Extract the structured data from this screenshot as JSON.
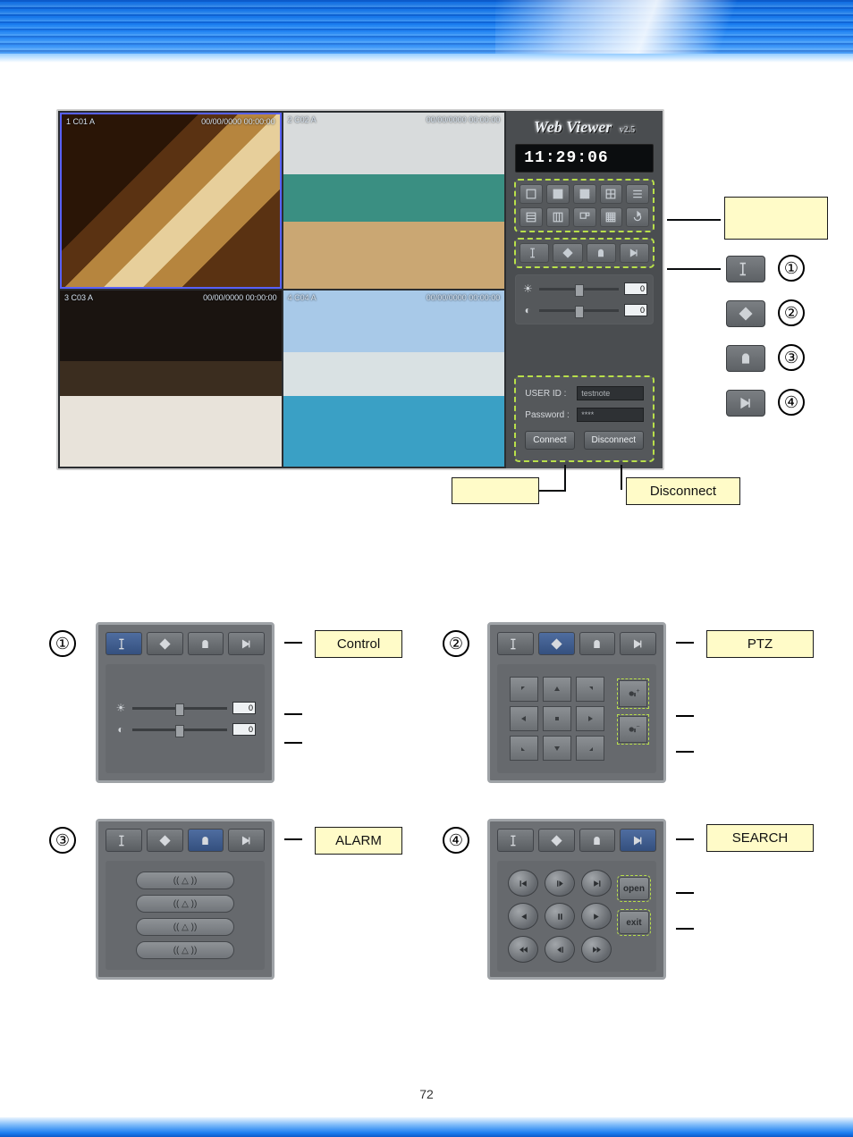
{
  "page_number": "72",
  "viewer": {
    "title": "Web Viewer",
    "version": "v2.5",
    "clock": "11:29:06",
    "feeds": [
      {
        "osd_left": "1 C01  A",
        "osd_right": "00/00/0000\n00:00:00"
      },
      {
        "osd_left": "2 C02  A",
        "osd_right": "00/00/0000\n00:00:00"
      },
      {
        "osd_left": "3 C03  A",
        "osd_right": "00/00/0000\n00:00:00"
      },
      {
        "osd_left": "4 C04  A",
        "osd_right": "00/00/0000\n00:00:00"
      }
    ],
    "slider1_value": "0",
    "slider2_value": "0",
    "login": {
      "user_label": "USER ID :",
      "pass_label": "Password :",
      "user_value": "testnote",
      "pass_value": "****",
      "connect": "Connect",
      "disconnect": "Disconnect"
    }
  },
  "callouts": {
    "screen_division": "",
    "tab_legend": {
      "n1": "①",
      "n2": "②",
      "n3": "③",
      "n4": "④"
    },
    "connect": "",
    "disconnect": "Disconnect"
  },
  "panels": {
    "p1": {
      "num": "①",
      "label": "Control",
      "slider1": "0",
      "slider2": "0"
    },
    "p2": {
      "num": "②",
      "label": "PTZ"
    },
    "p3": {
      "num": "③",
      "label": "ALARM",
      "alarm_text": "(( △ ))"
    },
    "p4": {
      "num": "④",
      "label": "SEARCH",
      "open": "open",
      "exit": "exit"
    }
  }
}
